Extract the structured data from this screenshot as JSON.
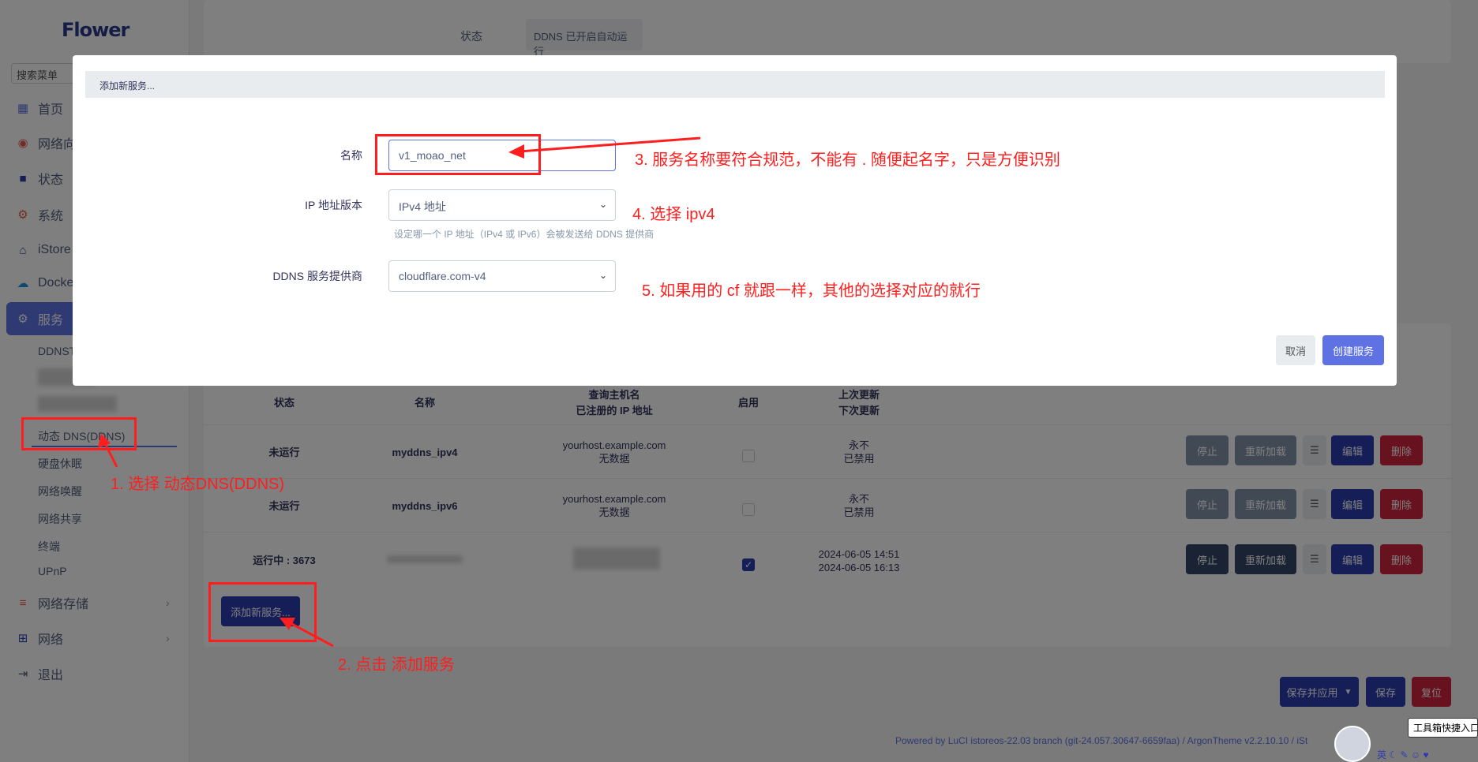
{
  "sidebar": {
    "logo": "Flower",
    "search_placeholder": "搜索菜单",
    "items": [
      {
        "label": "首页",
        "icon": "dashboard-icon"
      },
      {
        "label": "网络向",
        "icon": "globe-icon"
      },
      {
        "label": "状态",
        "icon": "grid-icon"
      },
      {
        "label": "系统",
        "icon": "gear-icon"
      },
      {
        "label": "iStore",
        "icon": "store-icon"
      },
      {
        "label": "Docke",
        "icon": "docker-icon"
      },
      {
        "label": "服务",
        "icon": "service-icon"
      },
      {
        "label": "网络存储",
        "icon": "storage-icon"
      },
      {
        "label": "网络",
        "icon": "network-icon"
      },
      {
        "label": "退出",
        "icon": "logout-icon"
      }
    ],
    "sub_items": [
      "DDNST",
      "动态 DNS(DDNS)",
      "硬盘休眠",
      "网络唤醒",
      "网络共享",
      "终端",
      "UPnP"
    ]
  },
  "status_row": {
    "label": "状态",
    "value": "DDNS 已开启自动运行"
  },
  "table": {
    "headers": {
      "status": "状态",
      "name": "名称",
      "host1": "查询主机名",
      "host2": "已注册的 IP 地址",
      "enable": "启用",
      "update1": "上次更新",
      "update2": "下次更新"
    },
    "rows": [
      {
        "status": "未运行",
        "name": "myddns_ipv4",
        "host": "yourhost.example.com",
        "ip": "无数据",
        "last": "永不",
        "next": "已禁用",
        "enabled": false
      },
      {
        "status": "未运行",
        "name": "myddns_ipv6",
        "host": "yourhost.example.com",
        "ip": "无数据",
        "last": "永不",
        "next": "已禁用",
        "enabled": false
      },
      {
        "status": "运行中 : 3673",
        "name": "",
        "host": "",
        "ip": "",
        "last": "2024-06-05 14:51",
        "next": "2024-06-05 16:13",
        "enabled": true
      }
    ],
    "buttons": {
      "stop": "停止",
      "reload": "重新加载",
      "menu": "☰",
      "edit": "编辑",
      "delete": "删除"
    }
  },
  "add_service_button": "添加新服务...",
  "bottom_buttons": {
    "save_apply": "保存并应用",
    "save": "保存",
    "reset": "复位"
  },
  "footer": "Powered by LuCI istoreos-22.03 branch (git-24.057.30647-6659faa) / ArgonTheme v2.2.10.10 / iSt",
  "tooltip": "工具箱快捷入口",
  "taskbar": {
    "ime": "英"
  },
  "modal": {
    "title": "添加新服务...",
    "name_label": "名称",
    "name_value": "v1_moao_net",
    "ipver_label": "IP 地址版本",
    "ipver_value": "IPv4 地址",
    "ipver_hint": "设定哪一个 IP 地址（IPv4 或 IPv6）会被发送给 DDNS 提供商",
    "provider_label": "DDNS 服务提供商",
    "provider_value": "cloudflare.com-v4",
    "cancel": "取消",
    "create": "创建服务"
  },
  "annotations": {
    "a1": "1. 选择 动态DNS(DDNS)",
    "a2": "2. 点击 添加服务",
    "a3": "3. 服务名称要符合规范，不能有 . 随便起名字，只是方便识别",
    "a4": "4. 选择 ipv4",
    "a5": "5. 如果用的 cf 就跟一样，其他的选择对应的就行"
  },
  "colors": {
    "accent": "#5e72e4",
    "primary": "#2c3cb0",
    "danger": "#d0233f",
    "annotation": "#ff1e1e"
  }
}
